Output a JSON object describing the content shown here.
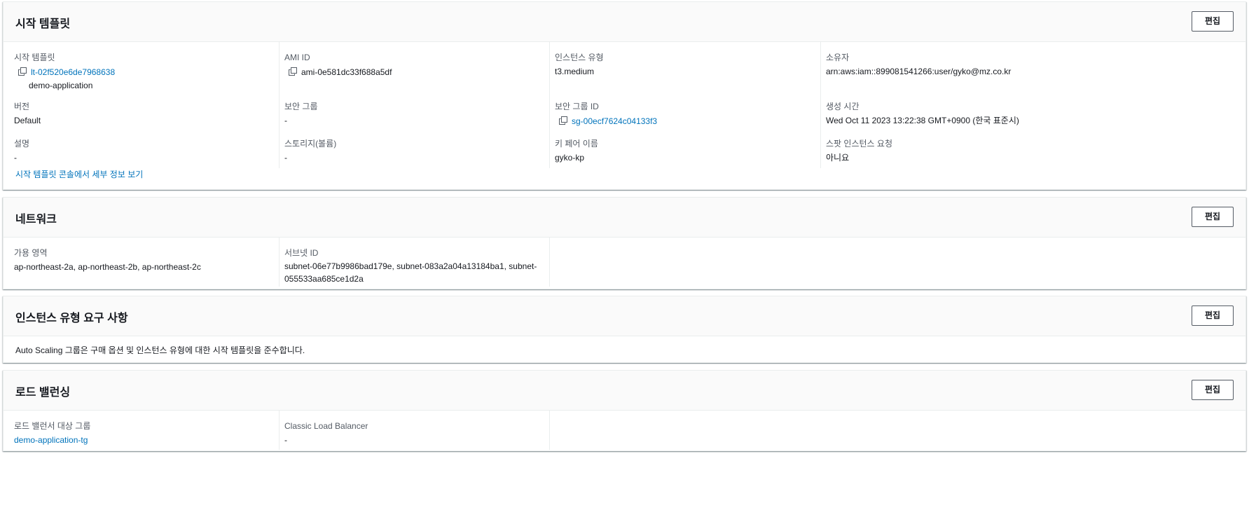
{
  "launch_template_panel": {
    "title": "시작 템플릿",
    "edit_label": "편집",
    "fields": {
      "launch_template": {
        "label": "시작 템플릿",
        "value": "lt-02f520e6de7968638",
        "sub": "demo-application"
      },
      "ami_id": {
        "label": "AMI ID",
        "value": "ami-0e581dc33f688a5df"
      },
      "instance_type": {
        "label": "인스턴스 유형",
        "value": "t3.medium"
      },
      "owner": {
        "label": "소유자",
        "value": "arn:aws:iam::899081541266:user/gyko@mz.co.kr"
      },
      "version": {
        "label": "버전",
        "value": "Default"
      },
      "security_groups": {
        "label": "보안 그룹",
        "value": "-"
      },
      "security_group_id": {
        "label": "보안 그룹 ID",
        "value": "sg-00ecf7624c04133f3"
      },
      "creation_time": {
        "label": "생성 시간",
        "value": "Wed Oct 11 2023 13:22:38 GMT+0900 (한국 표준시)"
      },
      "description": {
        "label": "설명",
        "value": "-"
      },
      "storage": {
        "label": "스토리지(볼륨)",
        "value": "-"
      },
      "key_pair": {
        "label": "키 페어 이름",
        "value": "gyko-kp"
      },
      "spot_request": {
        "label": "스팟 인스턴스 요청",
        "value": "아니요"
      }
    },
    "details_link": "시작 템플릿 콘솔에서 세부 정보 보기"
  },
  "network_panel": {
    "title": "네트워크",
    "edit_label": "편집",
    "fields": {
      "availability_zones": {
        "label": "가용 영역",
        "value": "ap-northeast-2a, ap-northeast-2b, ap-northeast-2c"
      },
      "subnet_id": {
        "label": "서브넷 ID",
        "value_line1": "subnet-06e77b9986bad179e, subnet-083a2a04a13184ba1, subnet-",
        "value_line2": "055533aa685ce1d2a"
      }
    }
  },
  "instance_type_panel": {
    "title": "인스턴스 유형 요구 사항",
    "edit_label": "편집",
    "text": "Auto Scaling 그룹은 구매 옵션 및 인스턴스 유형에 대한 시작 템플릿을 준수합니다."
  },
  "load_balancing_panel": {
    "title": "로드 밸런싱",
    "edit_label": "편집",
    "fields": {
      "target_groups": {
        "label": "로드 밸런서 대상 그룹",
        "value": "demo-application-tg"
      },
      "classic_lb": {
        "label": "Classic Load Balancer",
        "value": "-"
      }
    }
  },
  "colors": {
    "link": "#0073bb",
    "label": "#545b64",
    "text": "#16191f",
    "border": "#eaeded",
    "header_bg": "#fafafa"
  },
  "icons": [
    "copy-icon"
  ]
}
